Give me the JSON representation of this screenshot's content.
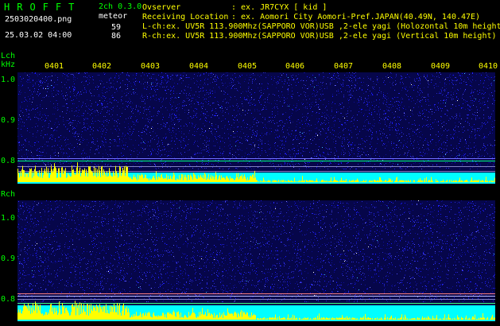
{
  "header": {
    "brand": "HROFFT",
    "mode": "2ch 0.3.0",
    "filename": "2503020400.png",
    "datetime": "25.03.02 04:00",
    "meteor_label": "meteor",
    "lch_count": "59",
    "rch_count": "86",
    "observer_label": "Ovserver",
    "observer_value": ": ex. JR7CYX [ kid ]",
    "location_label": "Receiving Location",
    "location_value": ": ex. Aomori City Aomori-Pref.JAPAN(40.49N, 140.47E)",
    "lch_info": "L-ch:ex. UV5R 113.900Mhz(SAPPORO VOR)USB ,2-ele yagi (Holozontal 10m height",
    "rch_info": "R-ch:ex. UV5R 113.900Mhz(SAPPORO VOR)USB ,2-ele yagi (Vertical 10m height)"
  },
  "time_labels": [
    "0401",
    "0402",
    "0403",
    "0404",
    "0405",
    "0406",
    "0407",
    "0408",
    "0409",
    "0410"
  ],
  "lch": {
    "label": "Lch",
    "unit": "kHz",
    "ticks": [
      "1.0",
      "0.9",
      "0.8"
    ]
  },
  "rch": {
    "label": "Rch",
    "ticks": [
      "1.0",
      "0.9",
      "0.8"
    ]
  },
  "colors": {
    "green": "#00ff00",
    "yellow": "#ffff00",
    "cyan": "#00ffff",
    "noise": "#0a0a8c"
  }
}
